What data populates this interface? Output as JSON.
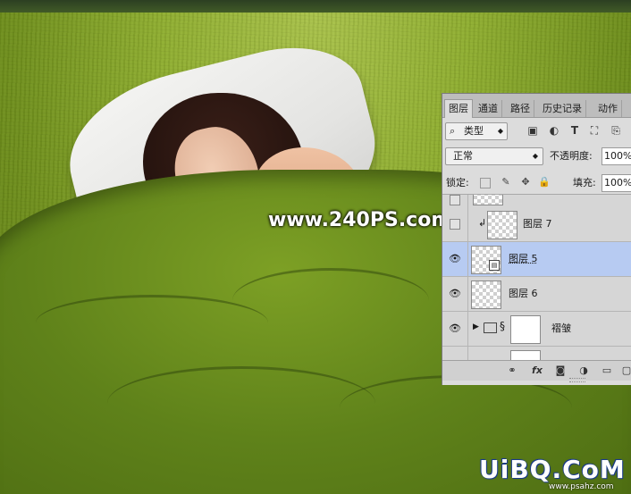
{
  "photo": {
    "watermark_text": "www.240PS.com",
    "logo_text": "UiBQ.CoM",
    "logo_sub_text": "www.psahz.com"
  },
  "layers_panel": {
    "tabs": [
      {
        "label": "图层",
        "active": true
      },
      {
        "label": "通道",
        "active": false
      },
      {
        "label": "路径",
        "active": false
      },
      {
        "label": "历史记录",
        "active": false
      },
      {
        "label": "动作",
        "active": false
      }
    ],
    "filter_kind": {
      "icon": "search-icon",
      "value": "类型"
    },
    "filter_icons": [
      "image-filter-icon",
      "adjustment-filter-icon",
      "text-filter-icon",
      "shape-filter-icon",
      "smart-object-filter-icon"
    ],
    "blend_mode": "正常",
    "opacity_label": "不透明度:",
    "opacity_value": "100%",
    "lock_label": "锁定:",
    "fill_label": "填充:",
    "fill_value": "100%",
    "layers": [
      {
        "name": "",
        "visible": false,
        "thumb": "checker",
        "partial": true
      },
      {
        "name": "图层 7",
        "visible": false,
        "thumb": "checker",
        "clipped": true
      },
      {
        "name": "图层 5",
        "visible": true,
        "thumb": "checker",
        "selected": true,
        "smart_object": true
      },
      {
        "name": "图层 6",
        "visible": true,
        "thumb": "checker"
      },
      {
        "name": "褶皱",
        "visible": true,
        "thumb": "white",
        "group": true,
        "collapsed": true
      },
      {
        "name": "",
        "visible": true,
        "thumb": "white",
        "partial": true
      }
    ],
    "bottom_icons": [
      "link-layers-icon",
      "fx-icon",
      "layer-mask-icon",
      "adjustment-layer-icon",
      "new-group-icon",
      "new-layer-icon"
    ]
  }
}
